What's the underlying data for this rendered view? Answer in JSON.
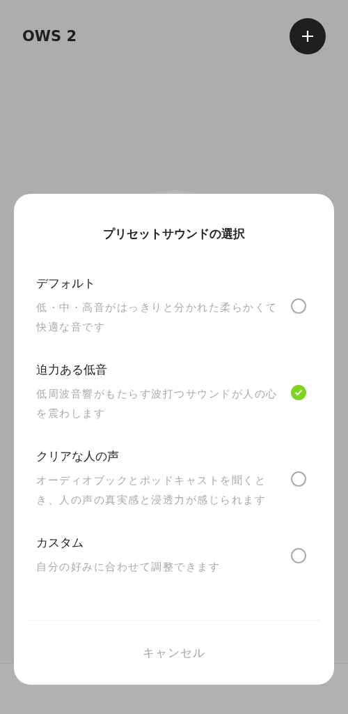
{
  "header": {
    "title": "OWS 2"
  },
  "dialog": {
    "title": "プリセットサウンドの選択",
    "options": [
      {
        "name": "デフォルト",
        "description": "低・中・高音がはっきりと分かれた柔らかくて快適な音です",
        "selected": false
      },
      {
        "name": "迫力ある低音",
        "description": "低周波音響がもたらす波打つサウンドが人の心を震わします",
        "selected": true
      },
      {
        "name": "クリアな人の声",
        "description": "オーディオブックとポッドキャストを聞くとき、人の声の真実感と浸透力が感じられます",
        "selected": false
      },
      {
        "name": "カスタム",
        "description": "自分の好みに合わせて調整できます",
        "selected": false
      }
    ],
    "cancel": "キャンセル"
  }
}
